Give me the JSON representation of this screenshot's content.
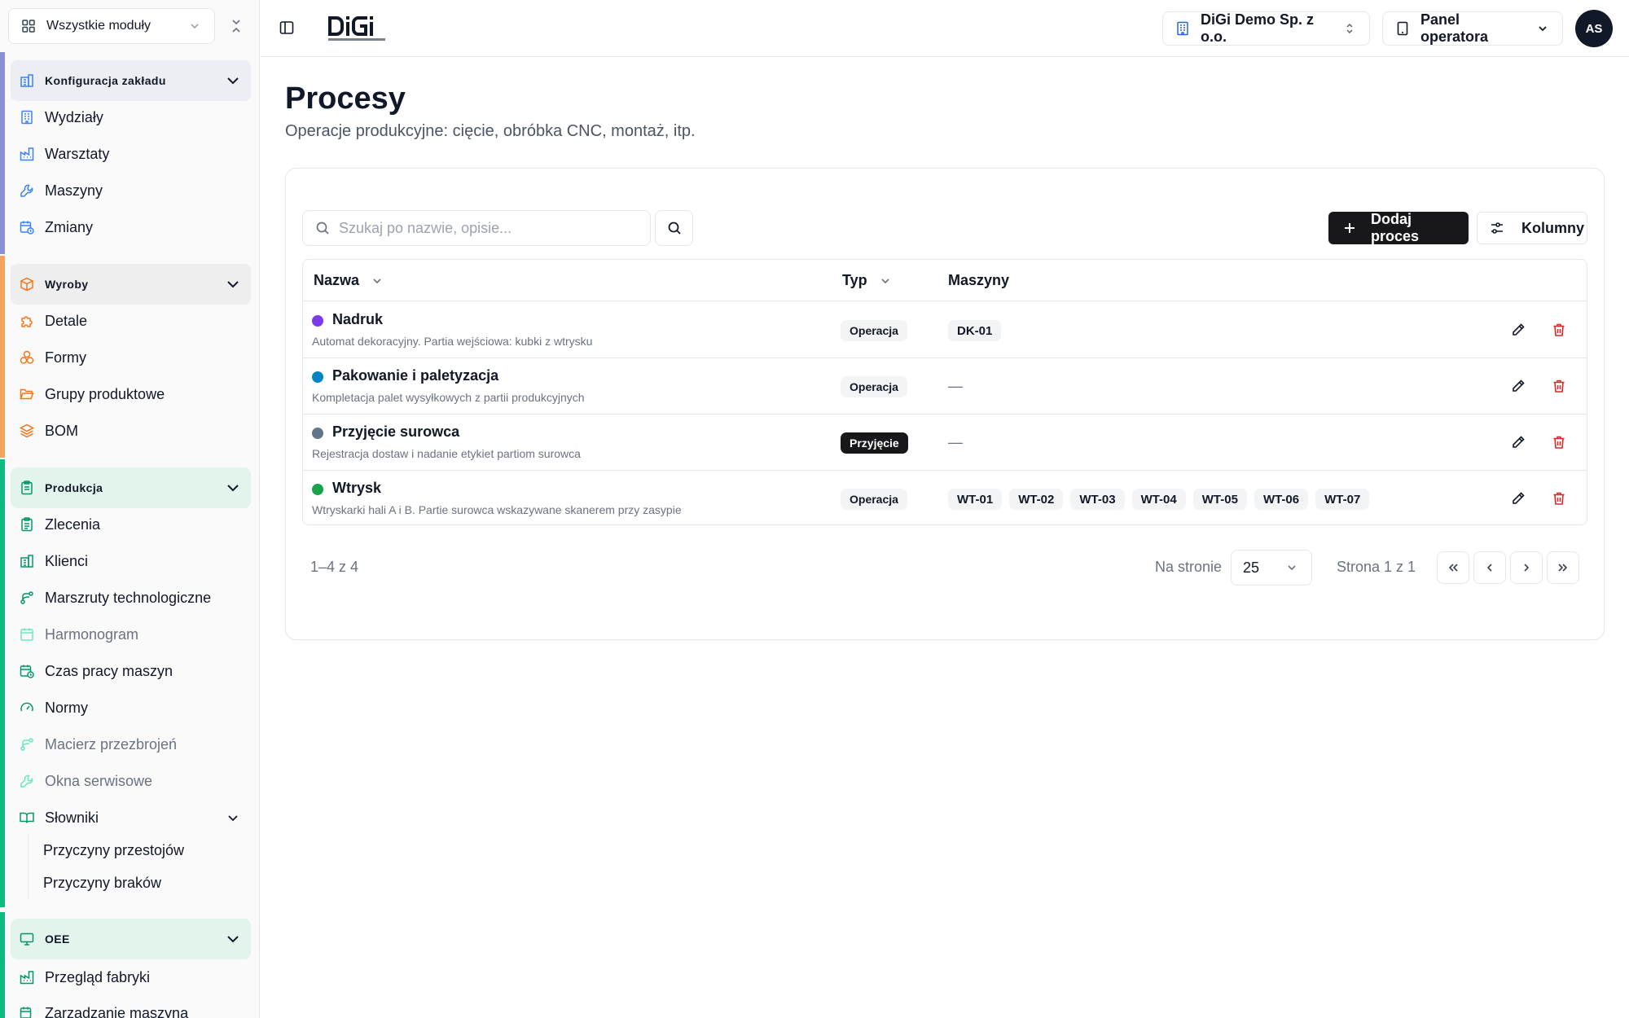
{
  "sidebar": {
    "module_select": "Wszystkie moduły",
    "sections": [
      {
        "title": "Konfiguracja zakładu",
        "color": "#6366f1",
        "items": [
          "Wydziały",
          "Warsztaty",
          "Maszyny",
          "Zmiany"
        ]
      },
      {
        "title": "Wyroby",
        "color": "#f97316",
        "items": [
          "Detale",
          "Formy",
          "Grupy produktowe",
          "BOM"
        ]
      },
      {
        "title": "Produkcja",
        "color": "#10b981",
        "items": [
          "Zlecenia",
          "Klienci",
          "Marszruty technologiczne",
          "Harmonogram",
          "Czas pracy maszyn",
          "Normy",
          "Macierz przezbrojeń",
          "Okna serwisowe",
          "Słowniki"
        ],
        "subitems": [
          "Przyczyny przestojów",
          "Przyczyny braków"
        ]
      },
      {
        "title": "OEE",
        "color": "#10b981",
        "items": [
          "Przegląd fabryki",
          "Zarządzanie maszyną"
        ]
      }
    ]
  },
  "topbar": {
    "company": "DiGi Demo Sp. z o.o.",
    "role": "Panel operatora",
    "avatar_initials": "AS"
  },
  "page": {
    "title": "Procesy",
    "subtitle": "Operacje produkcyjne: cięcie, obróbka CNC, montaż, itp."
  },
  "toolbar": {
    "search_placeholder": "Szukaj po nazwie, opisie...",
    "add_label": "Dodaj proces",
    "columns_label": "Kolumny"
  },
  "table": {
    "headers": {
      "name": "Nazwa",
      "type": "Typ",
      "machines": "Maszyny"
    },
    "rows": [
      {
        "name": "Nadruk",
        "desc": "Automat dekoracyjny. Partia wejściowa: kubki z wtrysku",
        "dot": "#7c3aed",
        "type": "Operacja",
        "machines": [
          "DK-01"
        ]
      },
      {
        "name": "Pakowanie i paletyzacja",
        "desc": "Kompletacja palet wysyłkowych z partii produkcyjnych",
        "dot": "#0284c7",
        "type": "Operacja",
        "machines": []
      },
      {
        "name": "Przyjęcie surowca",
        "desc": "Rejestracja dostaw i nadanie etykiet partiom surowca",
        "dot": "#64748b",
        "type": "Przyjęcie",
        "machines": []
      },
      {
        "name": "Wtrysk",
        "desc": "Wtryskarki hali A i B. Partie surowca wskazywane skanerem przy zasypie",
        "dot": "#16a34a",
        "type": "Operacja",
        "machines": [
          "WT-01",
          "WT-02",
          "WT-03",
          "WT-04",
          "WT-05",
          "WT-06",
          "WT-07"
        ]
      }
    ],
    "empty_marker": "—"
  },
  "pagination": {
    "count": "1–4 z 4",
    "per_page_label": "Na stronie",
    "per_page": "25",
    "page_info": "Strona 1 z 1"
  },
  "colors": {
    "primary_button": "#18181b",
    "delete": "#dc2626"
  }
}
